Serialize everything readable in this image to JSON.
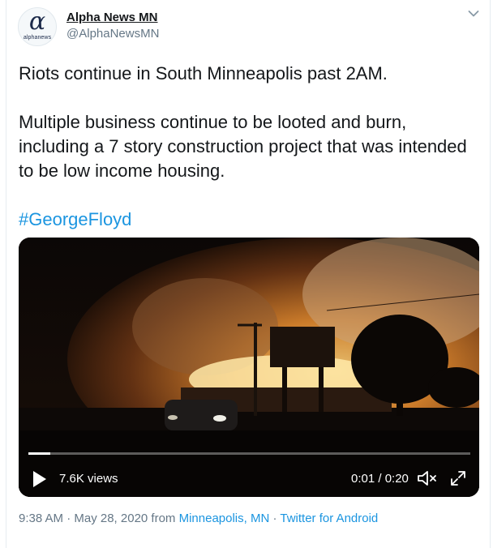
{
  "author": {
    "avatar_glyph": "α",
    "avatar_brand": "alphanews",
    "name": "Alpha News MN",
    "handle": "@AlphaNewsMN"
  },
  "tweet": {
    "paragraph_1": "Riots continue in South Minneapolis past 2AM.",
    "paragraph_2": "Multiple business continue to be looted and burn, including a 7 story construction project that was intended to be low income housing.",
    "hashtag": "#GeorgeFloyd"
  },
  "video": {
    "views": "7.6K views",
    "time": "0:01 / 0:20",
    "progress_fraction": 0.05
  },
  "meta": {
    "time": "9:38 AM · May 28, 2020 from ",
    "location": "Minneapolis, MN",
    "separator": " · ",
    "source": "Twitter for Android"
  },
  "colors": {
    "link": "#1b95e0",
    "secondary_text": "#657786"
  },
  "icons": [
    "chevron-down-icon",
    "play-icon",
    "mute-icon",
    "expand-icon"
  ]
}
